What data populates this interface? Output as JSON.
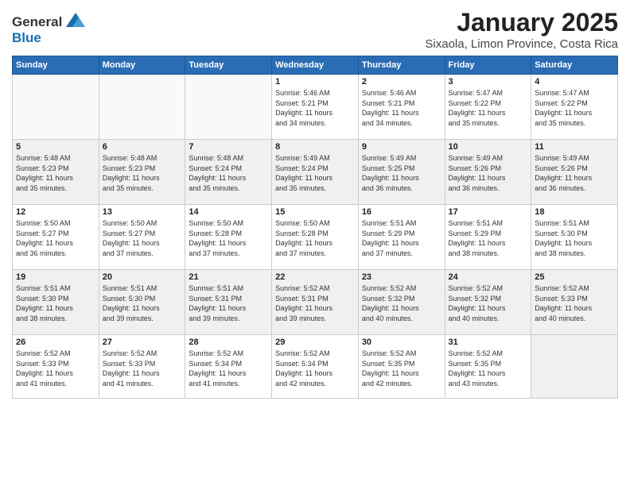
{
  "logo": {
    "general": "General",
    "blue": "Blue"
  },
  "title": "January 2025",
  "subtitle": "Sixaola, Limon Province, Costa Rica",
  "days_of_week": [
    "Sunday",
    "Monday",
    "Tuesday",
    "Wednesday",
    "Thursday",
    "Friday",
    "Saturday"
  ],
  "weeks": [
    [
      {
        "day": "",
        "info": ""
      },
      {
        "day": "",
        "info": ""
      },
      {
        "day": "",
        "info": ""
      },
      {
        "day": "1",
        "info": "Sunrise: 5:46 AM\nSunset: 5:21 PM\nDaylight: 11 hours and 34 minutes."
      },
      {
        "day": "2",
        "info": "Sunrise: 5:46 AM\nSunset: 5:21 PM\nDaylight: 11 hours and 34 minutes."
      },
      {
        "day": "3",
        "info": "Sunrise: 5:47 AM\nSunset: 5:22 PM\nDaylight: 11 hours and 35 minutes."
      },
      {
        "day": "4",
        "info": "Sunrise: 5:47 AM\nSunset: 5:22 PM\nDaylight: 11 hours and 35 minutes."
      }
    ],
    [
      {
        "day": "5",
        "info": "Sunrise: 5:48 AM\nSunset: 5:23 PM\nDaylight: 11 hours and 35 minutes."
      },
      {
        "day": "6",
        "info": "Sunrise: 5:48 AM\nSunset: 5:23 PM\nDaylight: 11 hours and 35 minutes."
      },
      {
        "day": "7",
        "info": "Sunrise: 5:48 AM\nSunset: 5:24 PM\nDaylight: 11 hours and 35 minutes."
      },
      {
        "day": "8",
        "info": "Sunrise: 5:49 AM\nSunset: 5:24 PM\nDaylight: 11 hours and 35 minutes."
      },
      {
        "day": "9",
        "info": "Sunrise: 5:49 AM\nSunset: 5:25 PM\nDaylight: 11 hours and 36 minutes."
      },
      {
        "day": "10",
        "info": "Sunrise: 5:49 AM\nSunset: 5:26 PM\nDaylight: 11 hours and 36 minutes."
      },
      {
        "day": "11",
        "info": "Sunrise: 5:49 AM\nSunset: 5:26 PM\nDaylight: 11 hours and 36 minutes."
      }
    ],
    [
      {
        "day": "12",
        "info": "Sunrise: 5:50 AM\nSunset: 5:27 PM\nDaylight: 11 hours and 36 minutes."
      },
      {
        "day": "13",
        "info": "Sunrise: 5:50 AM\nSunset: 5:27 PM\nDaylight: 11 hours and 37 minutes."
      },
      {
        "day": "14",
        "info": "Sunrise: 5:50 AM\nSunset: 5:28 PM\nDaylight: 11 hours and 37 minutes."
      },
      {
        "day": "15",
        "info": "Sunrise: 5:50 AM\nSunset: 5:28 PM\nDaylight: 11 hours and 37 minutes."
      },
      {
        "day": "16",
        "info": "Sunrise: 5:51 AM\nSunset: 5:29 PM\nDaylight: 11 hours and 37 minutes."
      },
      {
        "day": "17",
        "info": "Sunrise: 5:51 AM\nSunset: 5:29 PM\nDaylight: 11 hours and 38 minutes."
      },
      {
        "day": "18",
        "info": "Sunrise: 5:51 AM\nSunset: 5:30 PM\nDaylight: 11 hours and 38 minutes."
      }
    ],
    [
      {
        "day": "19",
        "info": "Sunrise: 5:51 AM\nSunset: 5:30 PM\nDaylight: 11 hours and 38 minutes."
      },
      {
        "day": "20",
        "info": "Sunrise: 5:51 AM\nSunset: 5:30 PM\nDaylight: 11 hours and 39 minutes."
      },
      {
        "day": "21",
        "info": "Sunrise: 5:51 AM\nSunset: 5:31 PM\nDaylight: 11 hours and 39 minutes."
      },
      {
        "day": "22",
        "info": "Sunrise: 5:52 AM\nSunset: 5:31 PM\nDaylight: 11 hours and 39 minutes."
      },
      {
        "day": "23",
        "info": "Sunrise: 5:52 AM\nSunset: 5:32 PM\nDaylight: 11 hours and 40 minutes."
      },
      {
        "day": "24",
        "info": "Sunrise: 5:52 AM\nSunset: 5:32 PM\nDaylight: 11 hours and 40 minutes."
      },
      {
        "day": "25",
        "info": "Sunrise: 5:52 AM\nSunset: 5:33 PM\nDaylight: 11 hours and 40 minutes."
      }
    ],
    [
      {
        "day": "26",
        "info": "Sunrise: 5:52 AM\nSunset: 5:33 PM\nDaylight: 11 hours and 41 minutes."
      },
      {
        "day": "27",
        "info": "Sunrise: 5:52 AM\nSunset: 5:33 PM\nDaylight: 11 hours and 41 minutes."
      },
      {
        "day": "28",
        "info": "Sunrise: 5:52 AM\nSunset: 5:34 PM\nDaylight: 11 hours and 41 minutes."
      },
      {
        "day": "29",
        "info": "Sunrise: 5:52 AM\nSunset: 5:34 PM\nDaylight: 11 hours and 42 minutes."
      },
      {
        "day": "30",
        "info": "Sunrise: 5:52 AM\nSunset: 5:35 PM\nDaylight: 11 hours and 42 minutes."
      },
      {
        "day": "31",
        "info": "Sunrise: 5:52 AM\nSunset: 5:35 PM\nDaylight: 11 hours and 43 minutes."
      },
      {
        "day": "",
        "info": ""
      }
    ]
  ]
}
